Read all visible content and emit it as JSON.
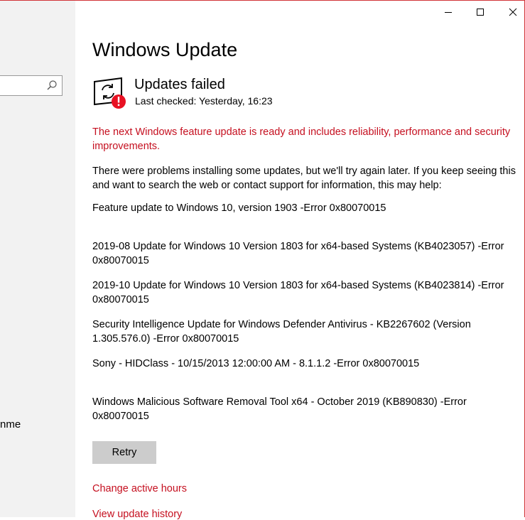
{
  "window": {
    "minimize_icon": "minimize-icon",
    "maximize_icon": "maximize-icon",
    "close_icon": "close-icon",
    "accent_color": "#d13438"
  },
  "sidebar": {
    "search_icon": "search-icon",
    "partial_item": "nme"
  },
  "page": {
    "title": "Windows Update",
    "status_title": "Updates failed",
    "last_checked": "Last checked: Yesterday, 16:23",
    "feature_notice": "The next Windows feature update is ready and includes reliability, performance and security improvements.",
    "problem_text": "There were problems installing some updates, but we'll try again later. If you keep seeing this and want to search the web or contact support for information, this may help:",
    "updates": [
      "Feature update to Windows 10, version 1903 -Error 0x80070015",
      "2019-08 Update for Windows 10 Version 1803 for x64-based Systems (KB4023057) -Error 0x80070015",
      "2019-10 Update for Windows 10 Version 1803 for x64-based Systems (KB4023814) -Error 0x80070015",
      "Security Intelligence Update for Windows Defender Antivirus - KB2267602 (Version 1.305.576.0) -Error 0x80070015",
      "Sony - HIDClass - 10/15/2013 12:00:00 AM - 8.1.1.2 -Error 0x80070015",
      "Windows Malicious Software Removal Tool x64 - October 2019 (KB890830) -Error 0x80070015"
    ],
    "retry_label": "Retry",
    "change_hours_link": "Change active hours",
    "history_link": "View update history",
    "error_color": "#c50f1f"
  }
}
